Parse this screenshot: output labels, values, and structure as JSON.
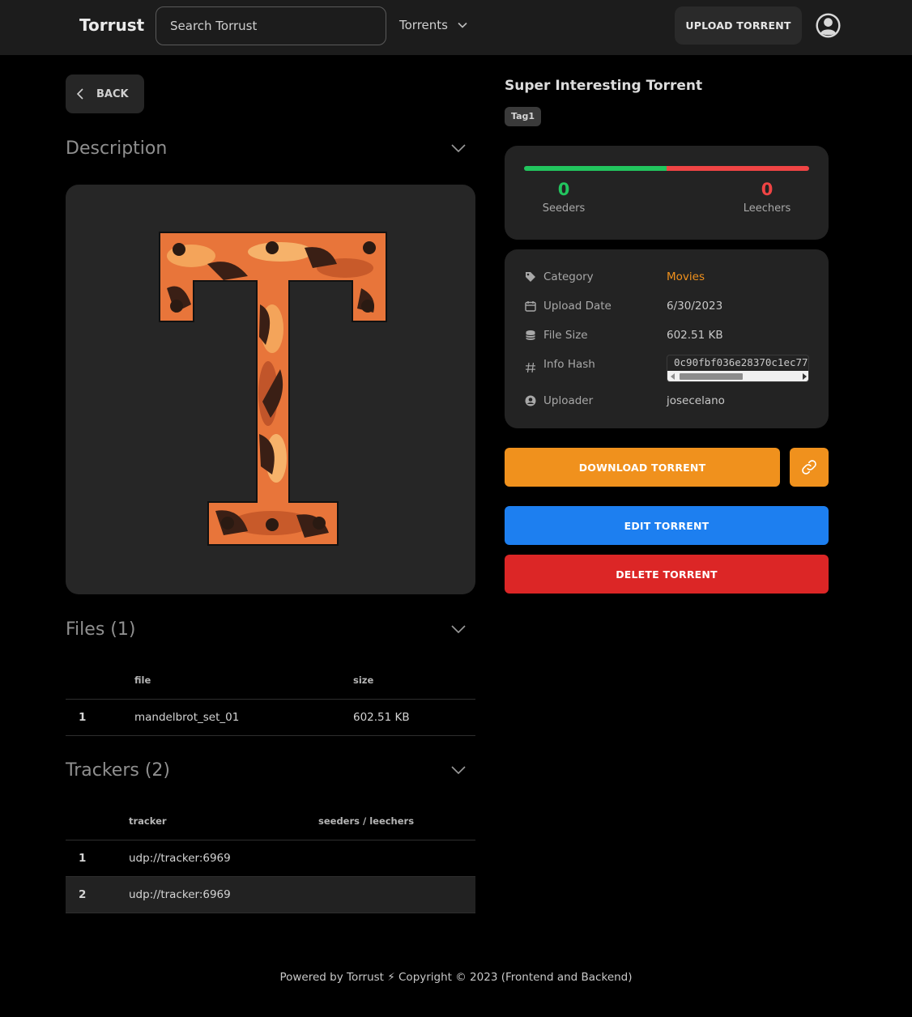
{
  "navbar": {
    "brand": "Torrust",
    "search_placeholder": "Search Torrust",
    "torrents_label": "Torrents",
    "upload_label": "UPLOAD TORRENT",
    "avatar_icon": "user-circle-icon"
  },
  "left": {
    "back_label": "BACK",
    "description_title": "Description",
    "files_title": "Files (1)",
    "files_columns": [
      "",
      "file",
      "size"
    ],
    "files_rows": [
      {
        "index": "1",
        "file": "mandelbrot_set_01",
        "size": "602.51 KB"
      }
    ],
    "trackers_title": "Trackers (2)",
    "trackers_columns": [
      "",
      "tracker",
      "seeders / leechers"
    ],
    "trackers_rows": [
      {
        "index": "1",
        "tracker": "udp://tracker:6969",
        "stats": ""
      },
      {
        "index": "2",
        "tracker": "udp://tracker:6969",
        "stats": ""
      }
    ]
  },
  "right": {
    "title": "Super Interesting Torrent",
    "tag": "Tag1",
    "seeders": "0",
    "seeders_label": "Seeders",
    "leechers": "0",
    "leechers_label": "Leechers",
    "colors": {
      "seeders": "#22c55e",
      "leechers": "#ef4444",
      "accent": "#f0911d",
      "edit": "#1d7ff0",
      "delete": "#dc2626"
    },
    "info": {
      "category_label": "Category",
      "category_value": "Movies",
      "upload_date_label": "Upload Date",
      "upload_date_value": "6/30/2023",
      "file_size_label": "File Size",
      "file_size_value": "602.51 KB",
      "info_hash_label": "Info Hash",
      "info_hash_value": "0c90fbf036e28370c1ec77",
      "uploader_label": "Uploader",
      "uploader_value": "josecelano"
    },
    "download_label": "DOWNLOAD TORRENT",
    "link_icon": "link-icon",
    "edit_label": "EDIT TORRENT",
    "delete_label": "DELETE TORRENT"
  },
  "footer": {
    "text": "Powered by Torrust ⚡ Copyright © 2023 (Frontend and Backend)"
  }
}
